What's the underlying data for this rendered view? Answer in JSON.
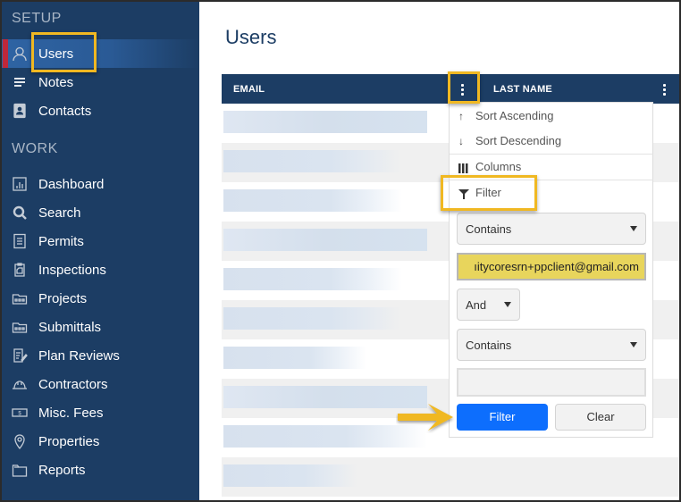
{
  "sidebar": {
    "sections": [
      {
        "label": "SETUP"
      },
      {
        "label": "WORK"
      }
    ],
    "items": [
      {
        "label": "Users",
        "icon": "user-icon",
        "active": true
      },
      {
        "label": "Notes",
        "icon": "notes-icon"
      },
      {
        "label": "Contacts",
        "icon": "contacts-icon"
      },
      {
        "label": "Dashboard",
        "icon": "dashboard-icon"
      },
      {
        "label": "Search",
        "icon": "search-icon"
      },
      {
        "label": "Permits",
        "icon": "permits-icon"
      },
      {
        "label": "Inspections",
        "icon": "inspections-icon"
      },
      {
        "label": "Projects",
        "icon": "projects-icon"
      },
      {
        "label": "Submittals",
        "icon": "submittals-icon"
      },
      {
        "label": "Plan Reviews",
        "icon": "plan-reviews-icon"
      },
      {
        "label": "Contractors",
        "icon": "hardhat-icon"
      },
      {
        "label": "Misc. Fees",
        "icon": "money-icon"
      },
      {
        "label": "Properties",
        "icon": "location-pin-icon"
      },
      {
        "label": "Reports",
        "icon": "folder-icon"
      }
    ]
  },
  "main": {
    "title": "Users",
    "grid": {
      "columns": [
        {
          "label": "EMAIL"
        },
        {
          "label": "LAST NAME"
        }
      ],
      "row_count": 10
    },
    "column_menu": {
      "items": [
        {
          "label": "Sort Ascending",
          "icon": "arrow-up-icon"
        },
        {
          "label": "Sort Descending",
          "icon": "arrow-down-icon"
        },
        {
          "label": "Columns",
          "icon": "columns-icon"
        },
        {
          "label": "Filter",
          "icon": "filter-icon"
        }
      ],
      "filter": {
        "operator1": "Contains",
        "value1": "ıitycoresrn+ppclient@gmail.com",
        "logic": "And",
        "operator2": "Contains",
        "value2": "",
        "apply_label": "Filter",
        "clear_label": "Clear"
      }
    }
  },
  "colors": {
    "sidebar_bg": "#1c3d64",
    "active_marker": "#c0283a",
    "highlight": "#f0b822",
    "primary_button": "#0d6efd"
  }
}
